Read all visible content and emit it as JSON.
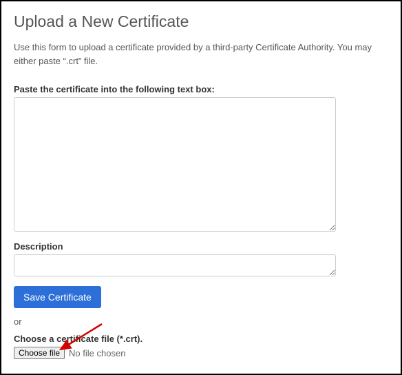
{
  "header": {
    "title": "Upload a New Certificate"
  },
  "instructions": "Use this form to upload a certificate provided by a third-party Certificate Authority. You may either paste “.crt” file.",
  "certificate": {
    "label": "Paste the certificate into the following text box:",
    "value": ""
  },
  "description": {
    "label": "Description",
    "value": ""
  },
  "buttons": {
    "save": "Save Certificate"
  },
  "separator": "or",
  "file": {
    "label": "Choose a certificate file (*.crt).",
    "button": "Choose file",
    "status": "No file chosen"
  }
}
